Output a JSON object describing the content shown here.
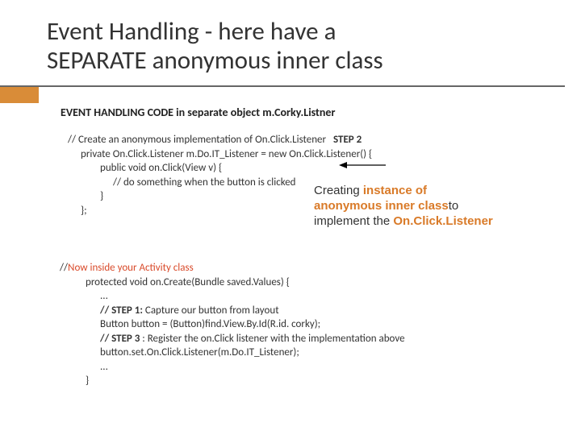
{
  "title_line1": "Event Handling -  here have a",
  "title_line2": "SEPARATE anonymous inner class",
  "subheading_prefix": "EVENT HANDLING CODE in separate object ",
  "subheading_obj": "m.Corky.Listner",
  "block1": {
    "l1": "// Create an anonymous implementation of On.Click.Listener",
    "l1_step": "STEP 2",
    "l2": "private On.Click.Listener m.Do.IT_Listener = new On.Click.Listener() {",
    "l3": "public void on.Click(View v) {",
    "l4": "// do something when the button is clicked",
    "l5": "}",
    "l6": "};"
  },
  "callout": {
    "p1a": "Creating ",
    "p1b": "instance of",
    "p2a": "anonymous inner class",
    "p2b": "to",
    "p3a": "implement the ",
    "p3b": "On.Click.Listener"
  },
  "block2": {
    "l1a": "//",
    "l1b": "Now inside your Activity class",
    "l2": "protected void on.Create(Bundle saved.Values) {",
    "l3": "...",
    "l4a": "// STEP 1:",
    "l4b": "    Capture our button from layout",
    "l5": "Button button = (Button)find.View.By.Id(R.id. corky);",
    "l6a": "// STEP 3",
    "l6b": " : Register the on.Click listener with the implementation above",
    "l7": "button.set.On.Click.Listener(m.Do.IT_Listener);",
    "l8": "...",
    "l9": "}"
  }
}
